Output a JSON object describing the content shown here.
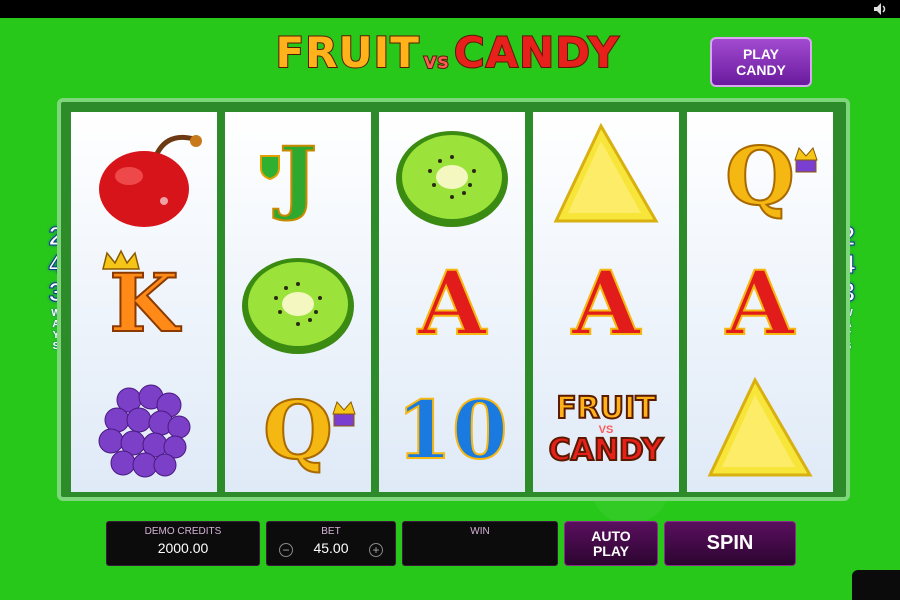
{
  "logo": {
    "word1": "FRUIT",
    "vs": "VS",
    "word2": "CANDY"
  },
  "play_candy_button": {
    "line1": "PLAY",
    "line2": "CANDY"
  },
  "ways": {
    "number": [
      "2",
      "4",
      "3"
    ],
    "label": "WAYS"
  },
  "reels": [
    [
      "cherry",
      "K",
      "grapes"
    ],
    [
      "J",
      "kiwi",
      "Q"
    ],
    [
      "kiwi",
      "A",
      "10"
    ],
    [
      "pineapple",
      "A",
      "logo"
    ],
    [
      "Q",
      "A",
      "pineapple"
    ]
  ],
  "symbol_text": {
    "K": "K",
    "J": "J",
    "Q": "Q",
    "A": "A",
    "ten": "10",
    "logo_fruit": "FRUIT",
    "logo_vs": "VS",
    "logo_candy": "CANDY"
  },
  "bottom": {
    "demo_credits_label": "DEMO CREDITS",
    "demo_credits_value": "2000.00",
    "bet_label": "BET",
    "bet_value": "45.00",
    "bet_minus": "−",
    "bet_plus": "+",
    "win_label": "WIN",
    "auto_play_line1": "AUTO",
    "auto_play_line2": "PLAY",
    "spin_label": "SPIN"
  },
  "icons": {
    "sound": "speaker-icon",
    "crown": "crown-icon"
  },
  "colors": {
    "background_green": "#27c81a",
    "panel_purple": "#5a0f5f",
    "letter_red": "#e21b1b",
    "letter_gold": "#f5b712"
  }
}
